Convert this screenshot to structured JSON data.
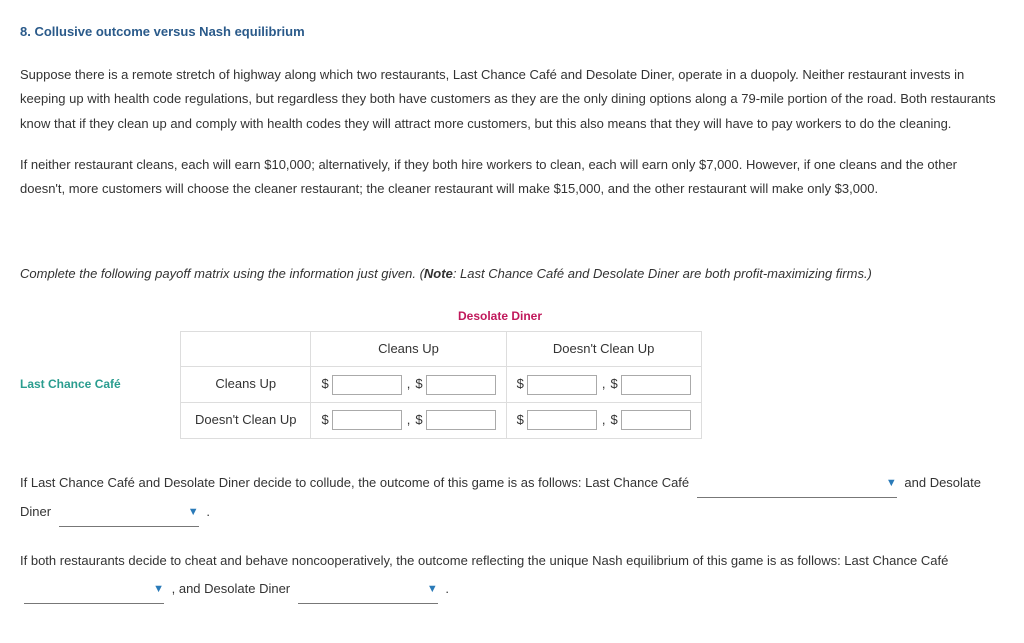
{
  "heading": "8. Collusive outcome versus Nash equilibrium",
  "para1": "Suppose there is a remote stretch of highway along which two restaurants, Last Chance Café and Desolate Diner, operate in a duopoly. Neither restaurant invests in keeping up with health code regulations, but regardless they both have customers as they are the only dining options along a 79-mile portion of the road. Both restaurants know that if they clean up and comply with health codes they will attract more customers, but this also means that they will have to pay workers to do the cleaning.",
  "para2": "If neither restaurant cleans, each will earn $10,000; alternatively, if they both hire workers to clean, each will earn only $7,000. However, if one cleans and the other doesn't, more customers will choose the cleaner restaurant; the cleaner restaurant will make $15,000, and the other restaurant will make only $3,000.",
  "instruction_pre": "Complete the following payoff matrix using the information just given. (",
  "instruction_note_label": "Note",
  "instruction_post": ": Last Chance Café and Desolate Diner are both profit-maximizing firms.)",
  "matrix": {
    "top_player": "Desolate Diner",
    "left_player": "Last Chance Café",
    "col1": "Cleans Up",
    "col2": "Doesn't Clean Up",
    "row1": "Cleans Up",
    "row2": "Doesn't Clean Up",
    "currency": "$",
    "comma": ","
  },
  "q1": {
    "pre": "If Last Chance Café and Desolate Diner decide to collude, the outcome of this game is as follows: Last Chance Café ",
    "mid": " and Desolate Diner ",
    "post": " ."
  },
  "q2": {
    "pre": "If both restaurants decide to cheat and behave noncooperatively, the outcome reflecting the unique Nash equilibrium of this game is as follows: Last Chance Café ",
    "mid": " , and Desolate Diner ",
    "post": " ."
  },
  "dropdown_arrow": "▼"
}
